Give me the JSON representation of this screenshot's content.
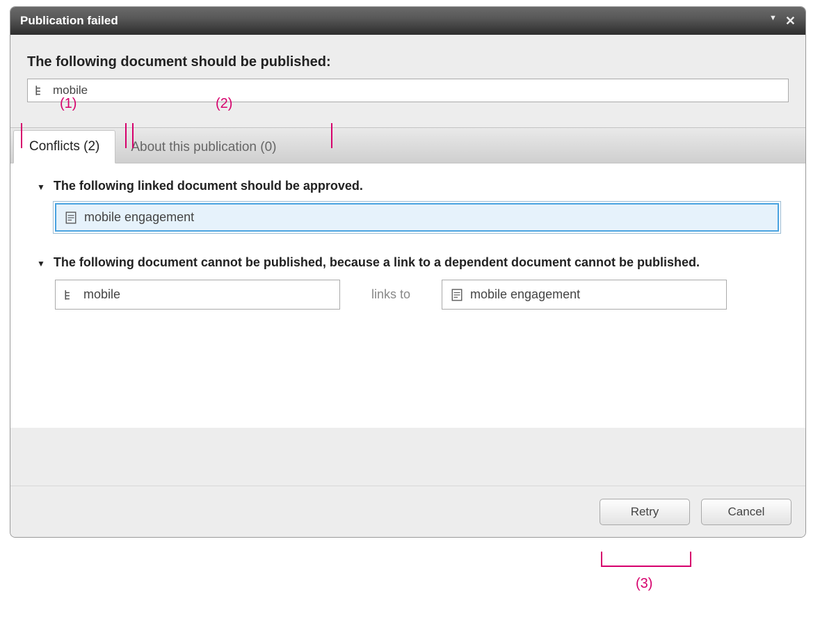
{
  "dialog": {
    "title": "Publication failed"
  },
  "header": {
    "heading": "The following document should be published:",
    "document_name": "mobile"
  },
  "tabs": {
    "conflicts": {
      "label": "Conflicts (2)",
      "count": 2
    },
    "about": {
      "label": "About this publication (0)",
      "count": 0
    }
  },
  "conflict1": {
    "heading": "The following linked document should be approved.",
    "doc": "mobile engagement"
  },
  "conflict2": {
    "heading": "The following document cannot be published, because a link to a dependent document cannot be published.",
    "source": "mobile",
    "links_to_label": "links to",
    "target": "mobile engagement"
  },
  "buttons": {
    "retry": "Retry",
    "cancel": "Cancel"
  },
  "annotations": {
    "a1": "(1)",
    "a2": "(2)",
    "a3": "(3)"
  }
}
